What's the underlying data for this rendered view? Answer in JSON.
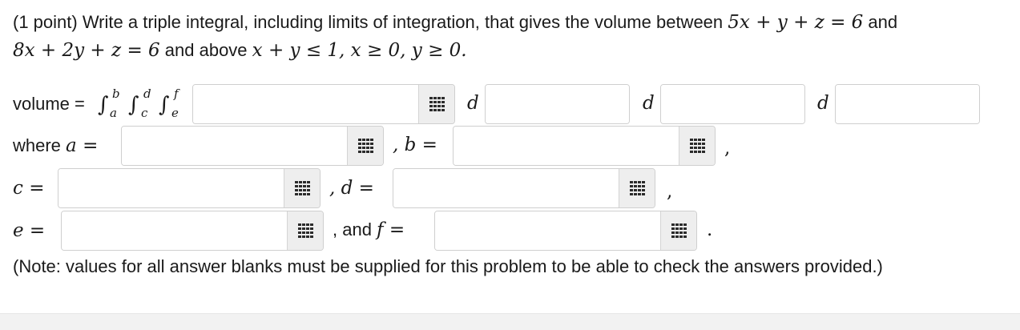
{
  "question": {
    "line1": {
      "prefix": "(1 point) Write a triple integral, including limits of integration, that gives the volume between ",
      "eq1": "5x + y + z = 6",
      "suffix": " and"
    },
    "line2": {
      "eq2": "8x + 2y + z = 6",
      "middle": " and above ",
      "ineq": "x + y ≤ 1, x ≥ 0, y ≥ 0."
    }
  },
  "volume_row": {
    "label": "volume = ",
    "integral_symbol": "∫",
    "limits": [
      {
        "upper": "b",
        "lower": "a"
      },
      {
        "upper": "d",
        "lower": "c"
      },
      {
        "upper": "f",
        "lower": "e"
      }
    ],
    "differential_symbol": "d",
    "fields": [
      {
        "name": "integrand",
        "value": ""
      },
      {
        "name": "differential-1",
        "value": ""
      },
      {
        "name": "differential-2",
        "value": ""
      },
      {
        "name": "differential-3",
        "value": ""
      }
    ]
  },
  "limits_rows": {
    "where_label": "where ",
    "a_label": "a =",
    "b_label": ", b =",
    "c_label": "c =",
    "d_label": ", d =",
    "e_label": "e =",
    "f_label_text": ", and ",
    "f_label_math": "f =",
    "comma": ",",
    "period": ".",
    "fields": {
      "a": {
        "value": ""
      },
      "b": {
        "value": ""
      },
      "c": {
        "value": ""
      },
      "d": {
        "value": ""
      },
      "e": {
        "value": ""
      },
      "f": {
        "value": ""
      }
    }
  },
  "note": "(Note: values for all answer blanks must be supplied for this problem to be able to check the answers provided.)",
  "icons": {
    "palette": "equation-editor-grid-icon"
  },
  "colors": {
    "panel_bg": "#ffffff",
    "page_bg": "#f4f4f4",
    "field_border": "#cfcfcf",
    "palette_bg": "#eeeeee"
  }
}
